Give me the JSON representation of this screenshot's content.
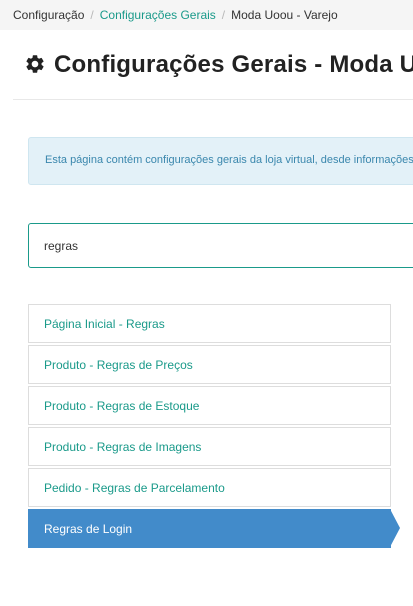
{
  "breadcrumb": {
    "items": [
      {
        "label": "Configuração"
      },
      {
        "label": "Configurações Gerais"
      },
      {
        "label": "Moda Uoou - Varejo"
      }
    ],
    "separator": "/"
  },
  "header": {
    "icon": "gear-icon",
    "title": "Configurações Gerais - Moda Uoou - Varejo"
  },
  "info": {
    "text": "Esta página contém configurações gerais da loja virtual, desde informações básicas até regras de funcionamento."
  },
  "search": {
    "value": "regras",
    "placeholder": ""
  },
  "results": {
    "items": [
      {
        "label": "Página Inicial - Regras"
      },
      {
        "label": "Produto - Regras de Preços"
      },
      {
        "label": "Produto - Regras de Estoque"
      },
      {
        "label": "Produto - Regras de Imagens"
      },
      {
        "label": "Pedido - Regras de Parcelamento"
      },
      {
        "label": "Regras de Login"
      }
    ],
    "selected_index": 5
  },
  "colors": {
    "accent": "#1a9a8a",
    "selected": "#428bca",
    "info_bg": "#e3f1f8",
    "info_text": "#3a87ad"
  }
}
